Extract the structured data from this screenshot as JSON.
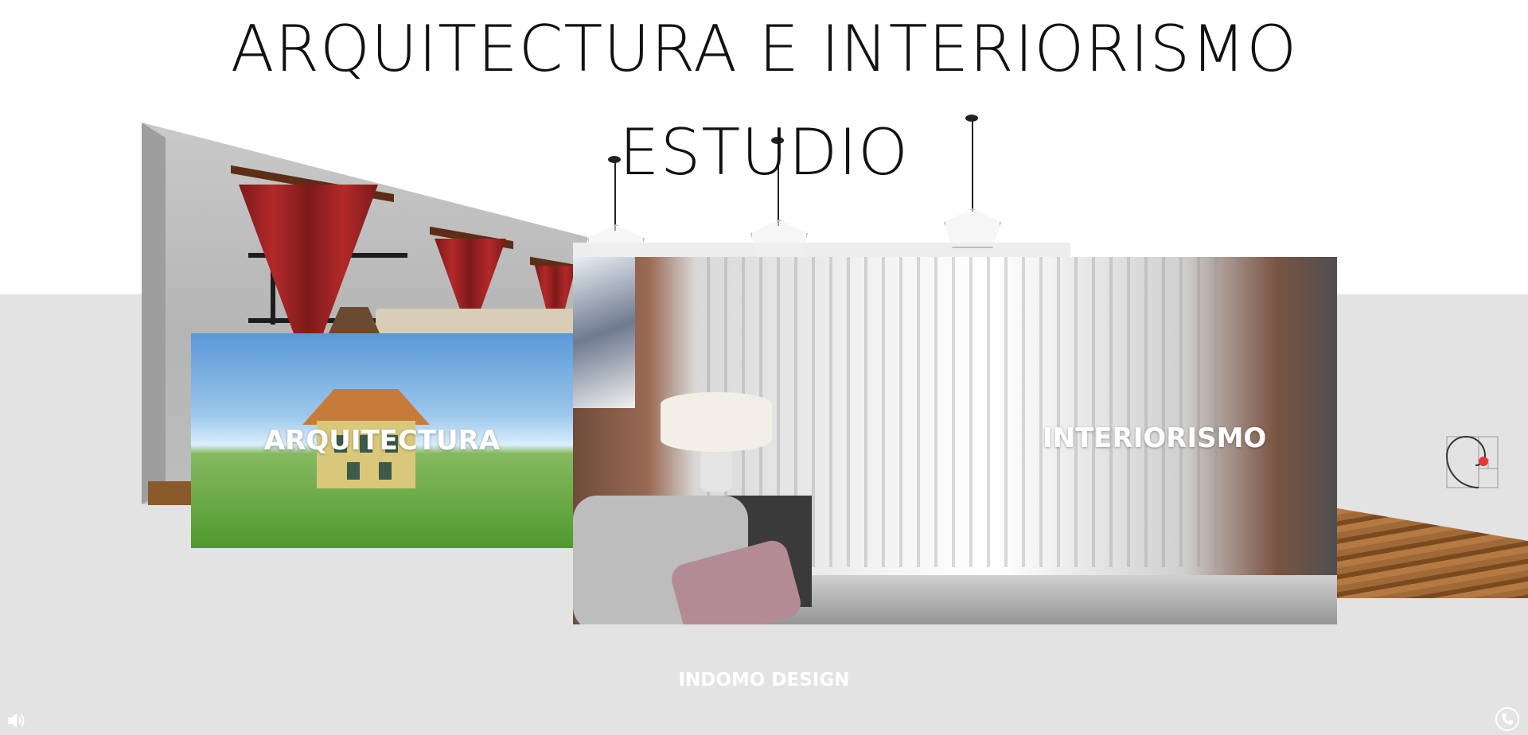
{
  "header": {
    "title_line1": "ARQUITECTURA E INTERIORISMO",
    "title_line2": "ESTUDIO"
  },
  "cards": {
    "arquitectura": {
      "label": "ARQUITECTURA"
    },
    "interiorismo": {
      "label": "INTERIORISMO"
    }
  },
  "footer": {
    "brand": "INDOMO DESIGN"
  },
  "icons": {
    "sound": "speaker-icon",
    "spiral": "golden-spiral-icon",
    "phone": "phone-icon"
  },
  "colors": {
    "floor": "#e3e3e3",
    "title": "#111111",
    "label": "#ffffff",
    "accent_red": "#e53935"
  }
}
